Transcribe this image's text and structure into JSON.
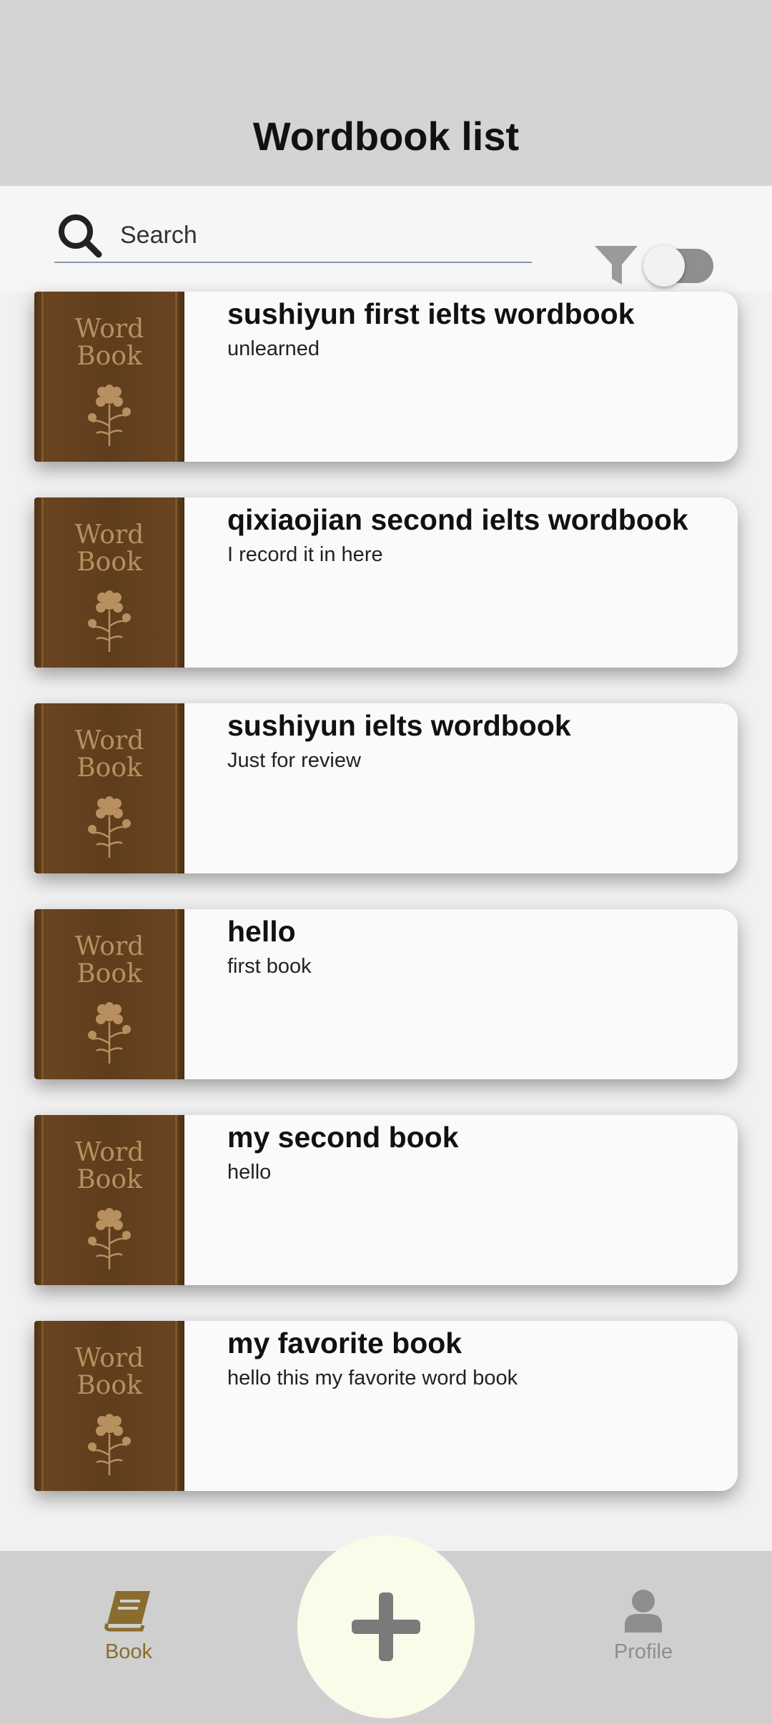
{
  "header": {
    "title": "Wordbook list"
  },
  "search": {
    "placeholder": "Search",
    "value": "",
    "filter_toggle_on": false
  },
  "cover": {
    "line1": "Word",
    "line2": "Book"
  },
  "books": [
    {
      "title": "sushiyun first ielts wordbook",
      "description": "unlearned"
    },
    {
      "title": "qixiaojian second ielts wordbook",
      "description": "I record it in here"
    },
    {
      "title": "sushiyun ielts wordbook",
      "description": "Just for review"
    },
    {
      "title": "hello",
      "description": "first book"
    },
    {
      "title": "my second book",
      "description": "hello"
    },
    {
      "title": "my favorite book",
      "description": "hello this my favorite word book"
    }
  ],
  "nav": {
    "items": [
      {
        "label": "Book",
        "icon": "book-icon",
        "active": true
      },
      {
        "label": "Profile",
        "icon": "person-icon",
        "active": false
      }
    ],
    "add_icon": "plus-icon"
  },
  "colors": {
    "header_bg": "#d4d4d4",
    "cover_brown": "#5f3d1c",
    "cover_gold": "#b89060",
    "nav_active": "#8a6c2e",
    "nav_inactive": "#8e8e8e",
    "fab_bg": "#fbfbea"
  }
}
